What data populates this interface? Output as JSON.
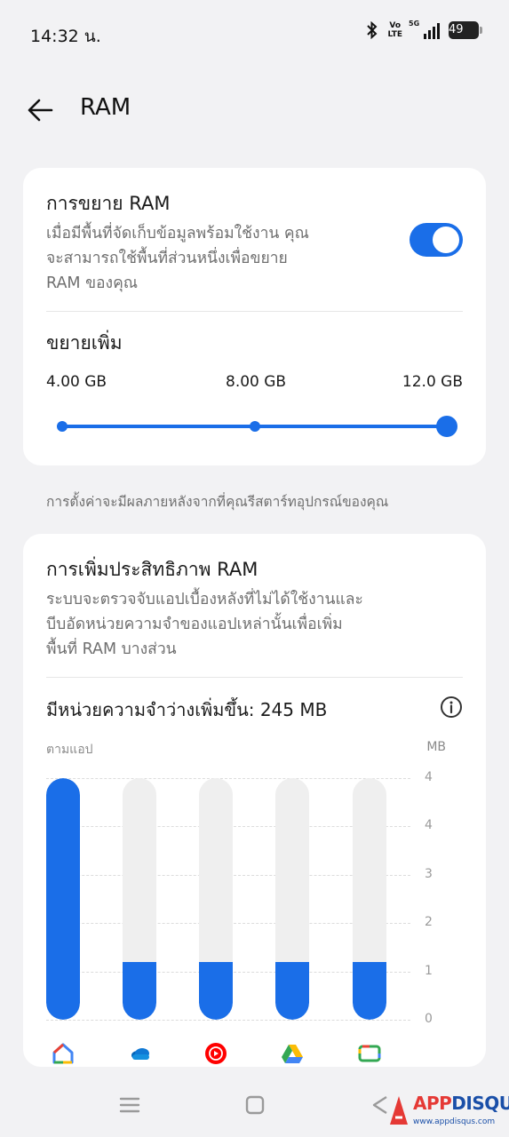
{
  "status_bar": {
    "time": "14:32 น.",
    "volte_top": "Vo",
    "volte_bottom": "LTE",
    "network": "5G",
    "battery": "49",
    "icons": [
      "bluetooth-icon",
      "volte-icon",
      "signal-5g-icon",
      "battery-icon"
    ]
  },
  "app_bar": {
    "title": "RAM",
    "back_icon": "arrow-left-icon"
  },
  "ram_expansion": {
    "title": "การขยาย RAM",
    "description_lines": [
      "เมื่อมีพื้นที่จัดเก็บข้อมูลพร้อมใช้งาน คุณ",
      "จะสามารถใช้พื้นที่ส่วนหนึ่งเพื่อขยาย",
      "RAM ของคุณ"
    ],
    "enabled": true,
    "expand_title": "ขยายเพิ่ม",
    "options": [
      "4.00 GB",
      "8.00 GB",
      "12.0 GB"
    ],
    "selected_index": 2
  },
  "restart_note": "การตั้งค่าจะมีผลภายหลังจากที่คุณรีสตาร์ทอุปกรณ์ของคุณ",
  "ram_optimization": {
    "title": "การเพิ่มประสิทธิภาพ RAM",
    "description_lines": [
      "ระบบจะตรวจจับแอปเบื้องหลังที่ไม่ได้ใช้งานและ",
      "บีบอัดหน่วยความจำของแอปเหล่านั้นเพื่อเพิ่ม",
      "พื้นที่ RAM บางส่วน"
    ],
    "freed_label": "มีหน่วยความจำว่างเพิ่มขึ้น: 245 MB",
    "info_icon": "info-icon"
  },
  "chart_data": {
    "type": "bar",
    "left_label": "ตามแอป",
    "unit_label": "MB",
    "y_ticks": [
      "4",
      "4",
      "3",
      "2",
      "1",
      "0"
    ],
    "categories": [
      "google-home-icon",
      "onedrive-icon",
      "youtube-music-icon",
      "google-drive-icon",
      "google-tv-icon"
    ],
    "values": [
      5.0,
      1.2,
      1.2,
      1.2,
      1.2
    ],
    "ylim": [
      0,
      5
    ],
    "colors": {
      "fill": "#1a6ee8",
      "track": "#efefef"
    }
  },
  "nav_bar": {
    "icons": [
      "recents-icon",
      "home-icon",
      "back-icon"
    ]
  },
  "watermark": {
    "brand_a": "APP",
    "brand_b": "DISQUS",
    "url": "www.appdisqus.com"
  },
  "colors": {
    "accent": "#1a6ee8",
    "background": "#f2f2f4",
    "card": "#ffffff"
  }
}
